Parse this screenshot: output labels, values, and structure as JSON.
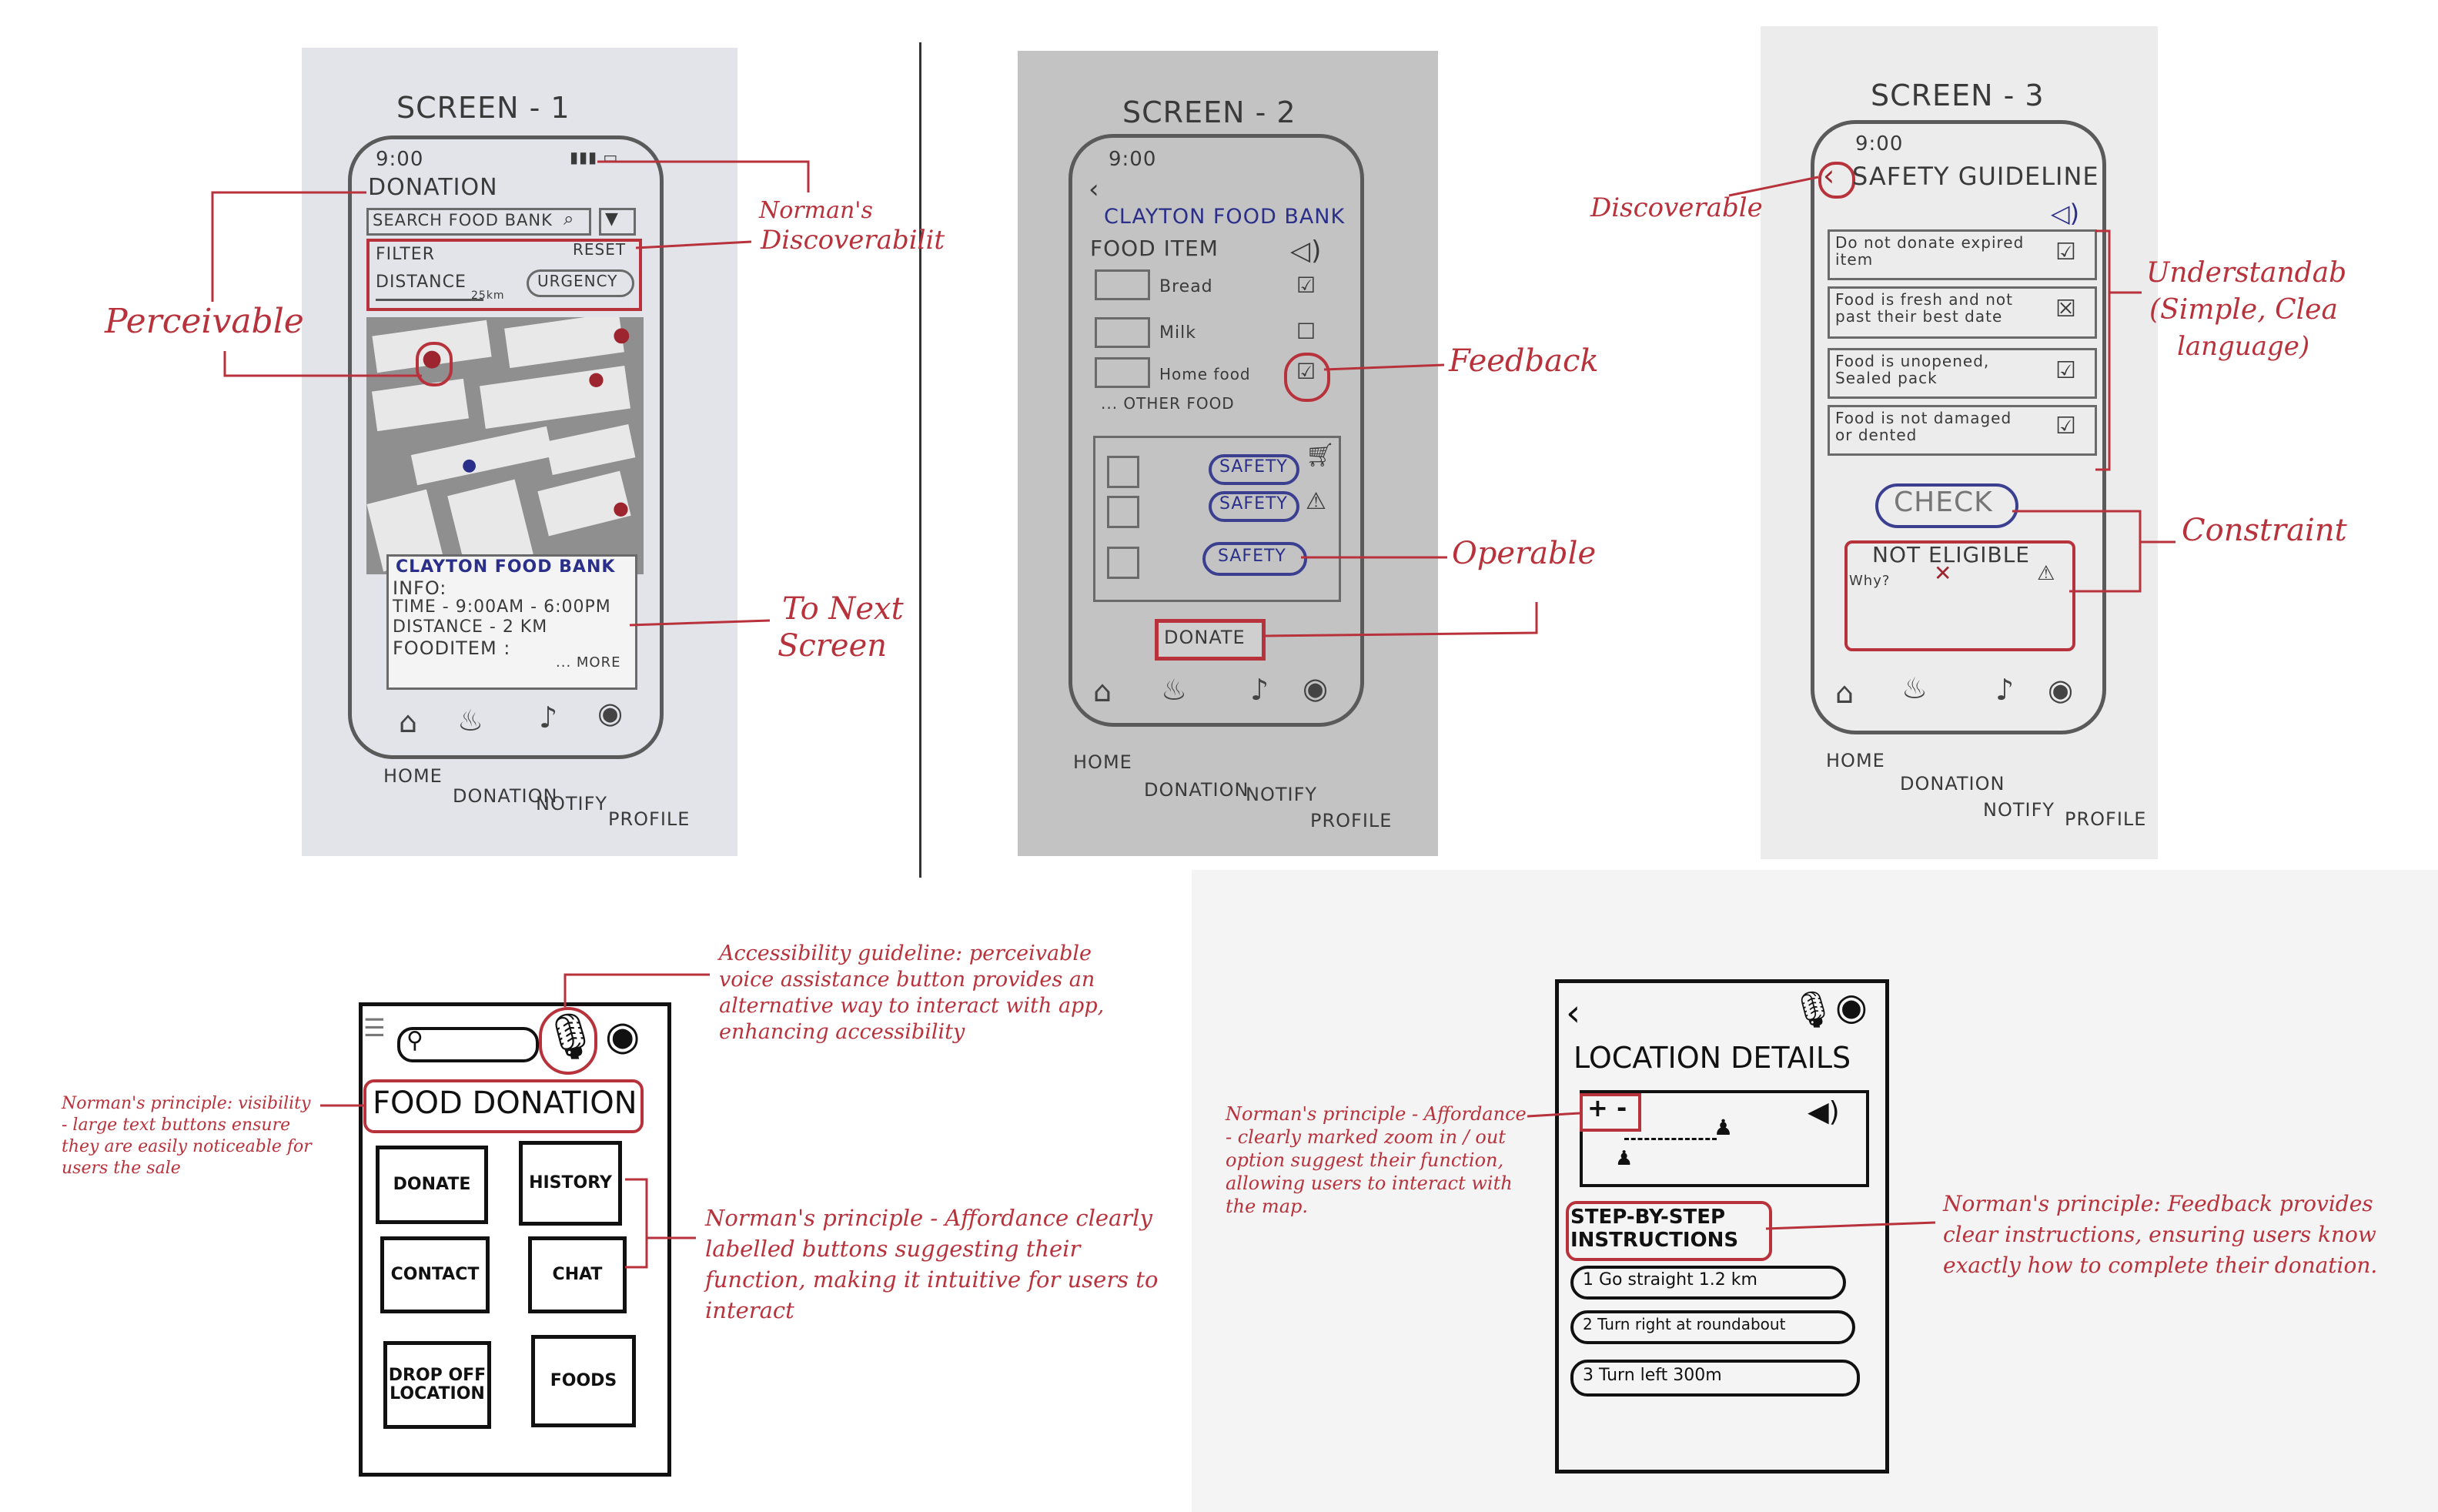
{
  "screen1": {
    "heading": "SCREEN - 1",
    "time": "9:00",
    "title": "DONATION",
    "search_label": "SEARCH FOOD BANK",
    "filter_label": "FILTER",
    "reset_label": "RESET",
    "distance_label": "DISTANCE",
    "distance_value": "25km",
    "urgency_label": "URGENCY",
    "card": {
      "name": "CLAYTON FOOD BANK",
      "info": "INFO:",
      "time": "TIME - 9:00AM - 6:00PM",
      "distance": "DISTANCE - 2 KM",
      "fooditem": "FOODITEM :",
      "more": "... MORE"
    },
    "tabs": [
      "HOME",
      "DONATION",
      "NOTIFY",
      "PROFILE"
    ],
    "annotations": {
      "perceivable": "Perceivable",
      "normans": "Norman's",
      "discoverability": "Discoverabilit",
      "to_next": "To Next",
      "screen": "Screen"
    }
  },
  "screen2": {
    "heading": "SCREEN - 2",
    "time": "9:00",
    "title": "CLAYTON FOOD BANK",
    "food_item_label": "FOOD ITEM",
    "items": [
      "Bread",
      "Milk",
      "Home food"
    ],
    "other_food": "... OTHER FOOD",
    "safety_label": "SAFETY",
    "donate_label": "DONATE",
    "tabs": [
      "HOME",
      "DONATION",
      "NOTIFY",
      "PROFILE"
    ],
    "annotations": {
      "feedback": "Feedback",
      "operable": "Operable"
    }
  },
  "screen3": {
    "heading": "SCREEN - 3",
    "time": "9:00",
    "title": "SAFETY GUIDELINE",
    "guidelines": [
      "Do not donate expired item",
      "Food is fresh and not past their best date",
      "Food is unopened, Sealed pack",
      "Food is not damaged or dented"
    ],
    "check_label": "CHECK",
    "not_eligible_label": "NOT ELIGIBLE",
    "why_label": "Why?",
    "tabs": [
      "HOME",
      "DONATION",
      "NOTIFY",
      "PROFILE"
    ],
    "annotations": {
      "discoverable": "Discoverable",
      "understandable": "Understandab",
      "simple": "(Simple, Clea",
      "language": "language)",
      "constraints": "Constraint"
    }
  },
  "wire_left": {
    "title": "FOOD DONATION",
    "buttons": [
      "DONATE",
      "HISTORY",
      "CONTACT",
      "CHAT",
      "DROP OFF LOCATION",
      "FOODS"
    ],
    "annotation_top": "Accessibility guideline: perceivable voice assistance button provides an alternative way to interact with app, enhancing accessibility",
    "annotation_left": "Norman's principle: visibility - large text buttons ensure they are easily noticeable for users the sale",
    "annotation_right": "Norman's principle - Affordance clearly labelled buttons suggesting their function, making it intuitive for users to interact"
  },
  "wire_right": {
    "title": "LOCATION DETAILS",
    "zoom_label": "+ -",
    "steps_title": "STEP-BY-STEP INSTRUCTIONS",
    "steps": [
      "1 Go straight 1.2 km",
      "2 Turn right at roundabout",
      "3 Turn left 300m"
    ],
    "annotation_left": "Norman's principle - Affordance - clearly marked zoom in / out option suggest their function, allowing users to interact with the map.",
    "annotation_right": "Norman's principle: Feedback provides clear instructions, ensuring users know exactly how to complete their donation."
  }
}
